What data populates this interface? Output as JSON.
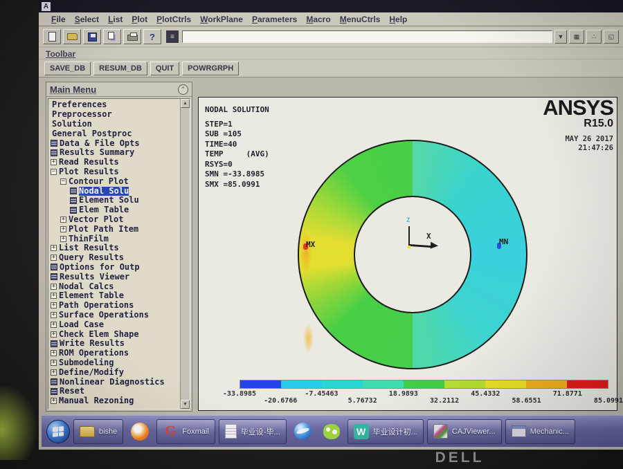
{
  "window": {
    "icon_letter": "A"
  },
  "menus": [
    "File",
    "Select",
    "List",
    "Plot",
    "PlotCtrls",
    "WorkPlane",
    "Parameters",
    "Macro",
    "MenuCtrls",
    "Help"
  ],
  "command_input": {
    "value": ""
  },
  "toolbar": {
    "label": "Toolbar",
    "buttons": [
      "SAVE_DB",
      "RESUM_DB",
      "QUIT",
      "POWRGRPH"
    ]
  },
  "main_menu": {
    "title": "Main Menu",
    "items": [
      {
        "label": "Preferences",
        "level": 0,
        "glyph": "none",
        "selected": false
      },
      {
        "label": "Preprocessor",
        "level": 0,
        "glyph": "none",
        "selected": false
      },
      {
        "label": "Solution",
        "level": 0,
        "glyph": "none",
        "selected": false
      },
      {
        "label": "General Postproc",
        "level": 0,
        "glyph": "none",
        "selected": false
      },
      {
        "label": "Data & File Opts",
        "level": 0,
        "glyph": "doc",
        "selected": false
      },
      {
        "label": "Results Summary",
        "level": 0,
        "glyph": "doc",
        "selected": false
      },
      {
        "label": "Read Results",
        "level": 0,
        "glyph": "plus",
        "selected": false
      },
      {
        "label": "Plot Results",
        "level": 0,
        "glyph": "minus",
        "selected": false
      },
      {
        "label": "Contour Plot",
        "level": 1,
        "glyph": "minus",
        "selected": false
      },
      {
        "label": "Nodal Solu",
        "level": 2,
        "glyph": "doc",
        "selected": true
      },
      {
        "label": "Element Solu",
        "level": 2,
        "glyph": "doc",
        "selected": false
      },
      {
        "label": "Elem Table",
        "level": 2,
        "glyph": "doc",
        "selected": false
      },
      {
        "label": "Vector Plot",
        "level": 1,
        "glyph": "plus",
        "selected": false
      },
      {
        "label": "Plot Path Item",
        "level": 1,
        "glyph": "plus",
        "selected": false
      },
      {
        "label": "ThinFilm",
        "level": 1,
        "glyph": "plus",
        "selected": false
      },
      {
        "label": "List Results",
        "level": 0,
        "glyph": "plus",
        "selected": false
      },
      {
        "label": "Query Results",
        "level": 0,
        "glyph": "plus",
        "selected": false
      },
      {
        "label": "Options for Outp",
        "level": 0,
        "glyph": "doc",
        "selected": false
      },
      {
        "label": "Results Viewer",
        "level": 0,
        "glyph": "doc",
        "selected": false
      },
      {
        "label": "Nodal Calcs",
        "level": 0,
        "glyph": "plus",
        "selected": false
      },
      {
        "label": "Element Table",
        "level": 0,
        "glyph": "plus",
        "selected": false
      },
      {
        "label": "Path Operations",
        "level": 0,
        "glyph": "plus",
        "selected": false
      },
      {
        "label": "Surface Operations",
        "level": 0,
        "glyph": "plus",
        "selected": false
      },
      {
        "label": "Load Case",
        "level": 0,
        "glyph": "plus",
        "selected": false
      },
      {
        "label": "Check Elem Shape",
        "level": 0,
        "glyph": "plus",
        "selected": false
      },
      {
        "label": "Write Results",
        "level": 0,
        "glyph": "doc",
        "selected": false
      },
      {
        "label": "ROM Operations",
        "level": 0,
        "glyph": "plus",
        "selected": false
      },
      {
        "label": "Submodeling",
        "level": 0,
        "glyph": "plus",
        "selected": false
      },
      {
        "label": "Define/Modify",
        "level": 0,
        "glyph": "plus",
        "selected": false
      },
      {
        "label": "Nonlinear Diagnostics",
        "level": 0,
        "glyph": "doc",
        "selected": false
      },
      {
        "label": "Reset",
        "level": 0,
        "glyph": "doc",
        "selected": false
      },
      {
        "label": "Manual Rezoning",
        "level": 0,
        "glyph": "plus",
        "selected": false
      }
    ]
  },
  "graphics": {
    "annotation": [
      "NODAL SOLUTION",
      "STEP=1",
      "SUB =105",
      "TIME=40",
      "TEMP     (AVG)",
      "RSYS=0",
      "SMN =-33.8985",
      "SMX =85.0991"
    ],
    "logo": {
      "brand": "ANSYS",
      "release": "R15.0",
      "date": "MAY 26 2017",
      "time": "21:47:26"
    },
    "marker_max": "MX",
    "marker_min": "MN",
    "axis_x": "X",
    "axis_z": "Z"
  },
  "chart_data": {
    "type": "heatmap",
    "title": "NODAL SOLUTION",
    "field": "TEMP (AVG)",
    "step": 1,
    "sub": 105,
    "time": 40,
    "rsys": 0,
    "smn": -33.8985,
    "smx": 85.0991,
    "geometry": "annulus ring, left half hot (yellow/green, MX at left outer edge), right half cold (cyan, MN at right outer edge)",
    "colorbar_values": [
      "-33.8985",
      "-20.6766",
      "-7.45463",
      "5.76732",
      "18.9893",
      "32.2112",
      "45.4332",
      "58.6551",
      "71.8771",
      "85.0991"
    ],
    "colorbar_colors": [
      "#1839e8",
      "#20c6e8",
      "#1ed4d4",
      "#38d8ac",
      "#38cc3c",
      "#b2dc2c",
      "#eade22",
      "#f0ac1a",
      "#de1814"
    ]
  },
  "taskbar": {
    "items": [
      {
        "type": "start",
        "icon": "windows-start",
        "label": ""
      },
      {
        "type": "task",
        "icon": "folder",
        "label": "bishe"
      },
      {
        "type": "icon",
        "icon": "firefox",
        "label": ""
      },
      {
        "type": "task",
        "icon": "foxmail",
        "label": "Foxmail"
      },
      {
        "type": "task",
        "icon": "doc",
        "label": "毕业设-毕..."
      },
      {
        "type": "icon",
        "icon": "browser",
        "label": ""
      },
      {
        "type": "icon",
        "icon": "wechat",
        "label": ""
      },
      {
        "type": "task",
        "icon": "wps",
        "label": "毕业设计初..."
      },
      {
        "type": "task",
        "icon": "caj",
        "label": "CAJViewer..."
      },
      {
        "type": "task",
        "icon": "mech",
        "label": "Mechanic..."
      }
    ]
  },
  "bezel": {
    "brand": "DELL"
  }
}
